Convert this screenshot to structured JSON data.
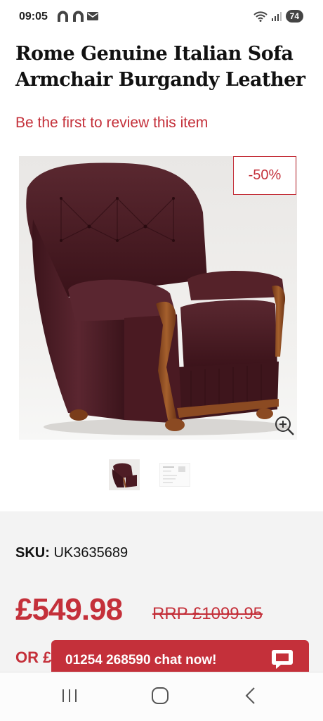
{
  "status_bar": {
    "time": "09:05",
    "left_icons": [
      "notification-arch-icon",
      "notification-arch-icon",
      "mail-icon"
    ],
    "right_icons": [
      "wifi-icon",
      "signal-icon"
    ],
    "battery": "74"
  },
  "product": {
    "title": "Rome Genuine Italian Sofa Armchair Burgandy Leather",
    "review_link": "Be the first to review this item",
    "discount_badge": "-50%",
    "sku_label": "SKU:",
    "sku_value": "UK3635689",
    "price": "£549.98",
    "rrp": "RRP £1099.95",
    "finance_prefix": "OR £"
  },
  "chat": {
    "label": "01254 268590 chat now!"
  },
  "colors": {
    "accent": "#c4303a",
    "leather": "#4a1a22",
    "wood": "#8b4a22"
  }
}
